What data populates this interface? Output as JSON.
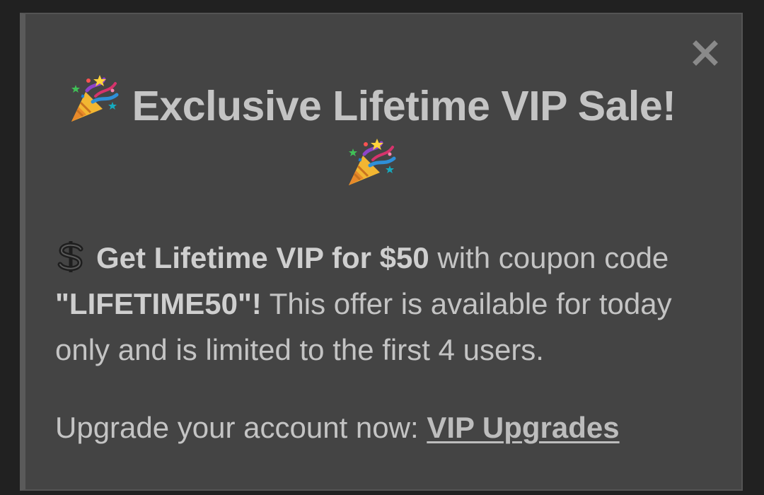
{
  "modal": {
    "title_text": "Exclusive Lifetime VIP Sale!",
    "title_icon": "party-popper-icon",
    "close_icon": "close-icon",
    "offer": {
      "icon": "heavy-dollar-sign-icon",
      "bold_part": "Get Lifetime VIP for $50",
      "text_part_1": " with coupon code ",
      "coupon_code": "\"LIFETIME50\"!",
      "text_part_2": " This offer is available for today only and is limited to the first 4 users."
    },
    "upgrade": {
      "prompt": "Upgrade your account now: ",
      "link_label": "VIP Upgrades"
    }
  },
  "colors": {
    "page_background": "#212121",
    "modal_background": "#444444",
    "text": "#c4c4c4",
    "close_icon": "#8a8a8a"
  }
}
